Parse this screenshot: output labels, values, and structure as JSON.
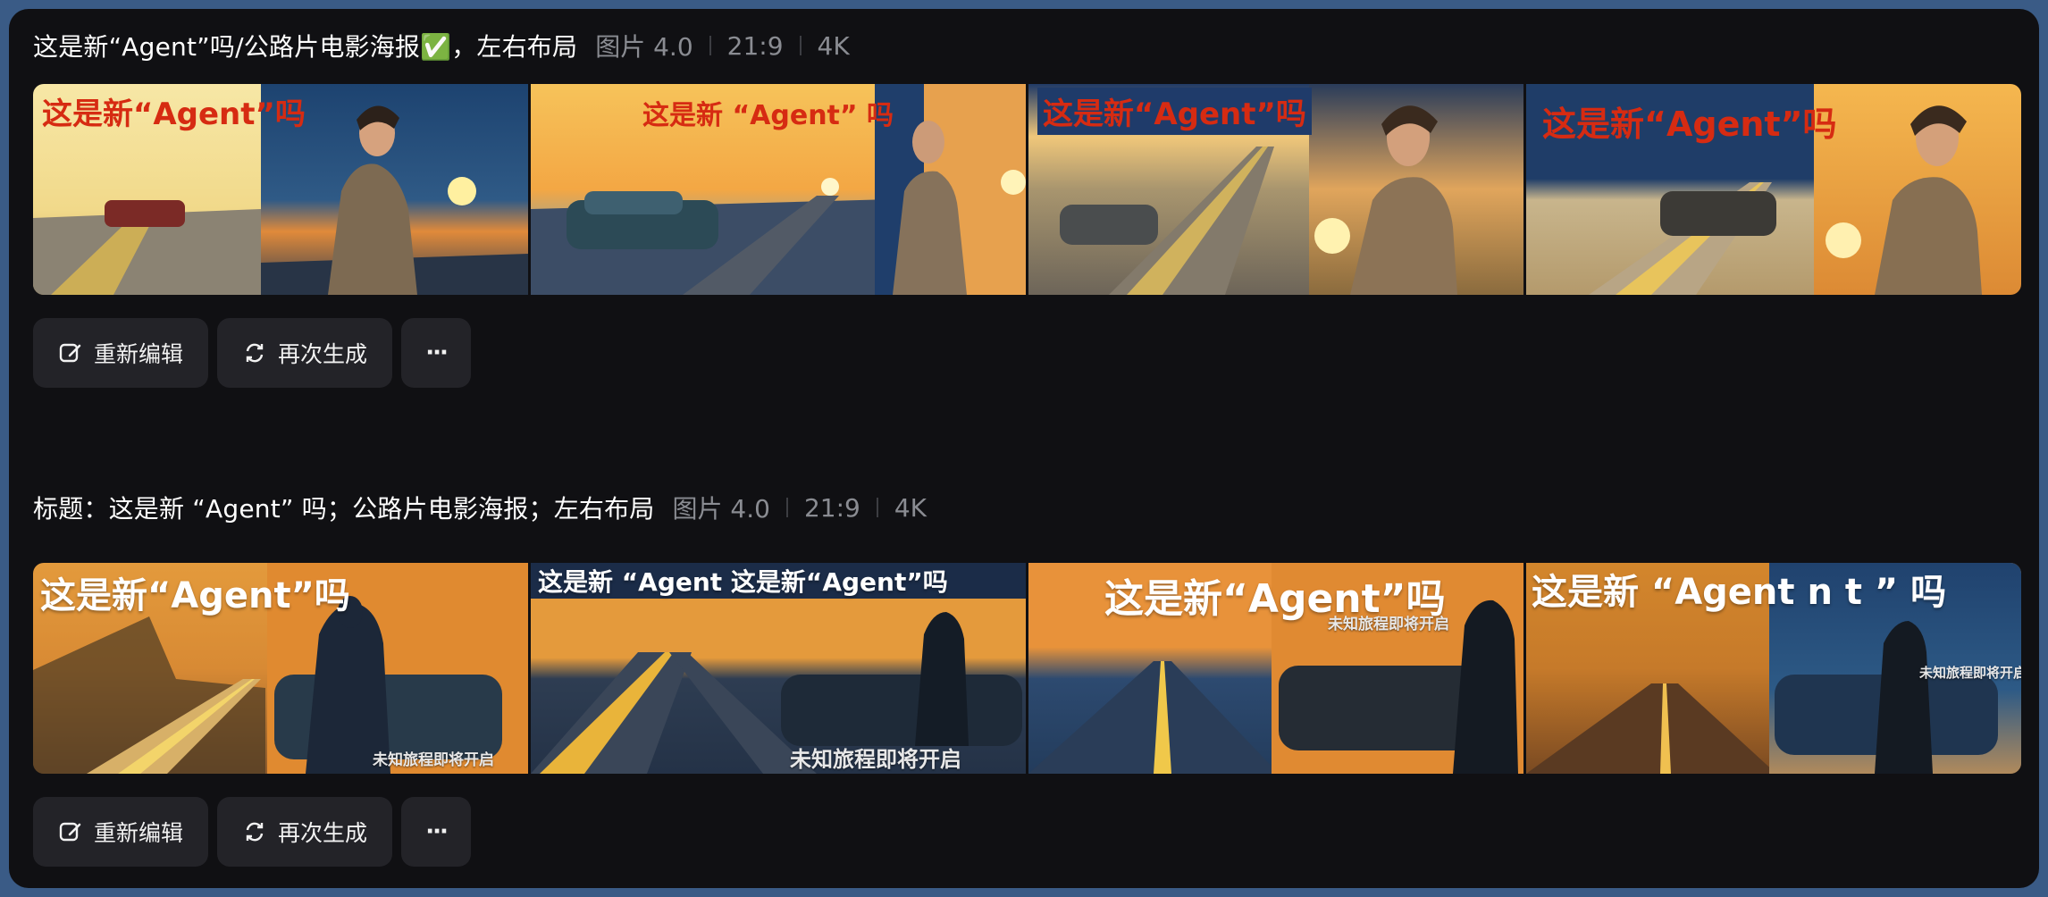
{
  "generations": [
    {
      "prompt": "这是新“Agent”吗/公路片电影海报✅，左右布局",
      "model": "图片 4.0",
      "ratio": "21:9",
      "resolution": "4K",
      "poster_titles": [
        "这是新“Agent”吗",
        "这是新 “Agent” 吗",
        "这是新“Agent”吗",
        "这是新“Agent”吗"
      ],
      "poster_subtitles": []
    },
    {
      "prompt": "标题：这是新 “Agent” 吗；公路片电影海报；左右布局",
      "model": "图片 4.0",
      "ratio": "21:9",
      "resolution": "4K",
      "poster_titles": [
        "这是新“Agent”吗",
        "这是新 “Agent 这是新“Agent”吗",
        "这是新“Agent”吗",
        "这是新 “Agent n t ” 吗"
      ],
      "poster_subtitles": [
        "未知旅程即将开启",
        "未知旅程即将开启",
        "未知旅程即将开启",
        "未知旅程即将开启"
      ]
    }
  ],
  "actions": {
    "edit_label": "重新编辑",
    "regenerate_label": "再次生成",
    "more_label": "···"
  },
  "colors": {
    "background": "#101013",
    "button_bg": "#232328",
    "meta_text": "#8a8c92",
    "poster_red_title": "#d62b12"
  },
  "icons": [
    "edit-icon",
    "regenerate-icon",
    "more-icon"
  ]
}
